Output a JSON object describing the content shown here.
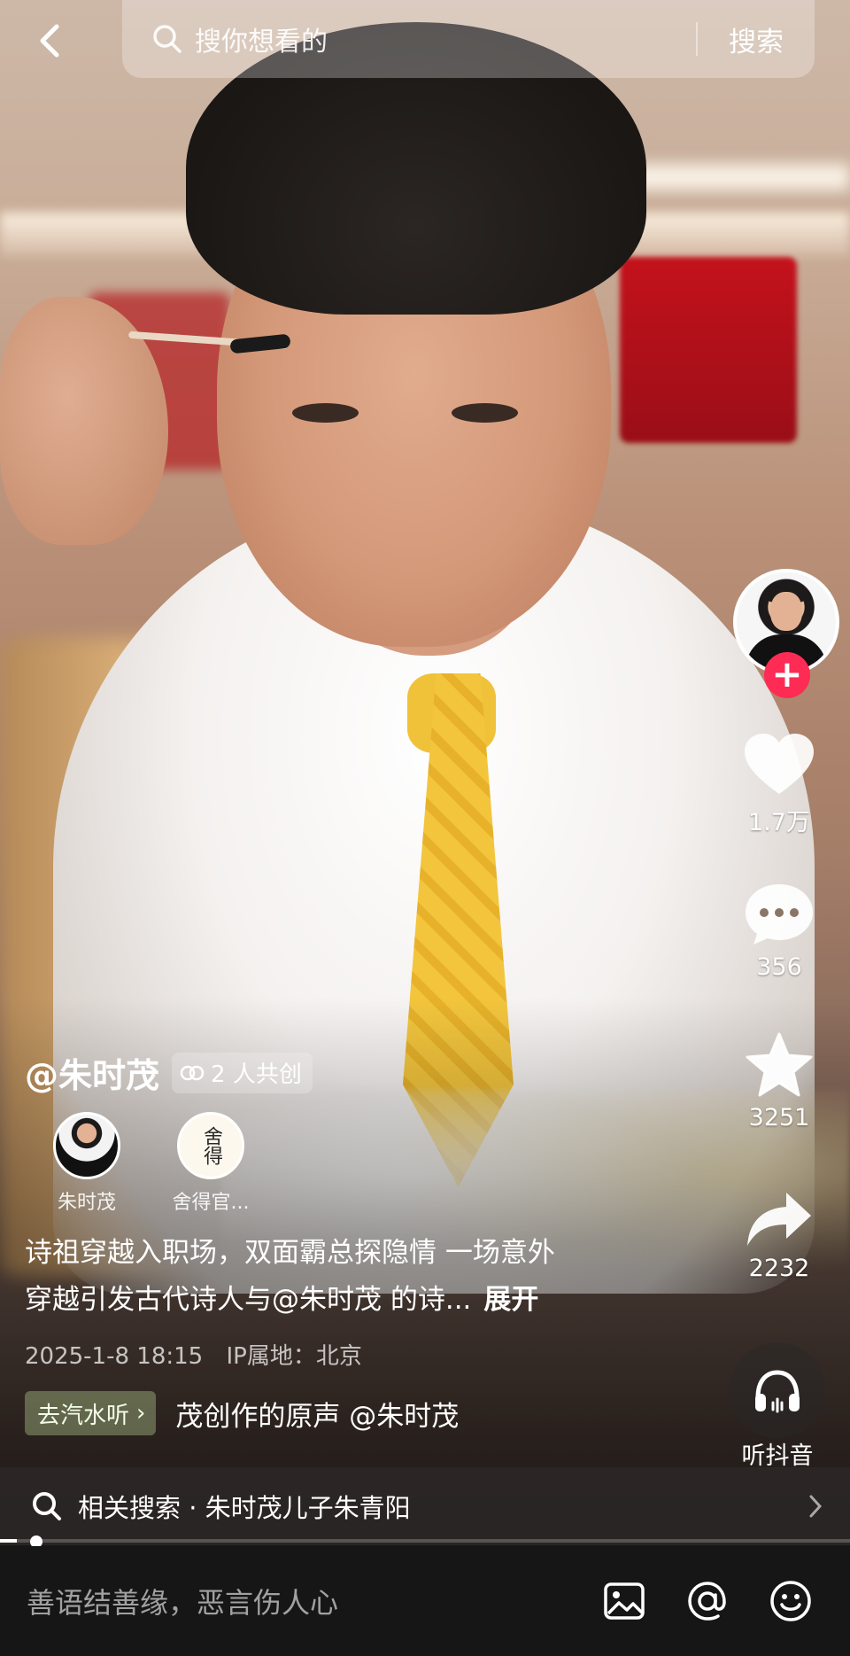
{
  "search": {
    "placeholder": "搜你想看的",
    "button": "搜索"
  },
  "video": {
    "author": "@朱时茂",
    "cocreate_label": "2 人共创",
    "creators": [
      {
        "name": "朱时茂"
      },
      {
        "name": "舍得官..."
      }
    ],
    "creator_logo_text": "舍得",
    "description_line1": "诗祖穿越入职场，双面霸总探隐情 一场意外",
    "description_line2": "穿越引发古代诗人与@朱时茂 的诗...",
    "expand_label": "展开",
    "date": "2025-1-8 18:15",
    "ip_location": "IP属地：北京",
    "soda_chip_label": "去汽水听",
    "music_text": "茂创作的原声    @朱时茂",
    "progress": 0.02
  },
  "rail": {
    "like_count": "1.7万",
    "comment_count": "356",
    "favorite_count": "3251",
    "share_count": "2232",
    "listen_label": "听抖音"
  },
  "related_search": "相关搜索 · 朱时茂儿子朱青阳",
  "comment": {
    "placeholder": "善语结善缘，恶言伤人心"
  },
  "icons": [
    "back-icon",
    "search-icon",
    "follow-plus-icon",
    "heart-icon",
    "comment-icon",
    "star-icon",
    "share-icon",
    "headphones-icon",
    "chevron-right-icon",
    "image-icon",
    "at-icon",
    "emoji-icon",
    "cocreate-icon"
  ]
}
